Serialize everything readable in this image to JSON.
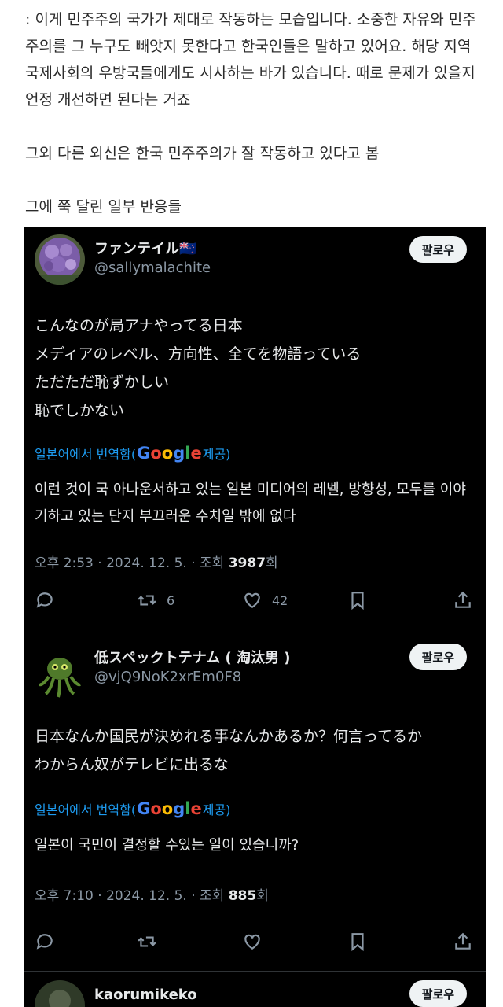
{
  "intro": {
    "paragraph1": ": 이게 민주주의 국가가 제대로 작동하는 모습입니다. 소중한 자유와 민주주의를 그 누구도 빼앗지 못한다고 한국인들은 말하고 있어요. 해당 지역 국제사회의 우방국들에게도 시사하는 바가 있습니다. 때로 문제가 있을지언정 개선하면 된다는 거죠",
    "paragraph2": "그외 다른 외신은 한국 민주주의가 잘 작동하고 있다고 봄",
    "paragraph3": "그에 쭉 달린 일부 반응들"
  },
  "tweets": [
    {
      "name": "ファンテイル🇳🇿",
      "handle": "@sallymalachite",
      "follow_label": "팔로우",
      "text_jp": "こんなのが局アナやってる日本\nメディアのレベル、方向性、全てを物語っている\nただただ恥ずかしい\n恥でしかない",
      "translated_prefix": "일본어에서 번역함(",
      "translated_suffix": " 제공)",
      "text_ko": "이런 것이 국 아나운서하고 있는 일본 미디어의 레벨, 방향성, 모두를 이야기하고 있는 단지 부끄러운 수치일 밖에 없다",
      "time": "오후 2:53 · 2024. 12. 5. · 조회 ",
      "views": "3987",
      "views_suffix": "회",
      "retweets": "6",
      "likes": "42"
    },
    {
      "name": "低スペックトテナム ( 淘汰男 )",
      "handle": "@vjQ9NoK2xrEm0F8",
      "follow_label": "팔로우",
      "text_jp": "日本なんか国民が決めれる事なんかあるか？何言ってるか\nわからん奴がテレビに出るな",
      "translated_prefix": "일본어에서 번역함(",
      "translated_suffix": " 제공)",
      "text_ko": "일본이 국민이 결정할 수있는 일이 있습니까?",
      "time": "오후 7:10 · 2024. 12. 5. · 조회 ",
      "views": "885",
      "views_suffix": "회"
    },
    {
      "name": "kaorumikeko",
      "follow_label": "팔로우"
    }
  ],
  "google": [
    "G",
    "o",
    "o",
    "g",
    "l",
    "e"
  ],
  "icons": [
    "reply-icon",
    "retweet-icon",
    "like-icon",
    "bookmark-icon",
    "share-icon"
  ]
}
